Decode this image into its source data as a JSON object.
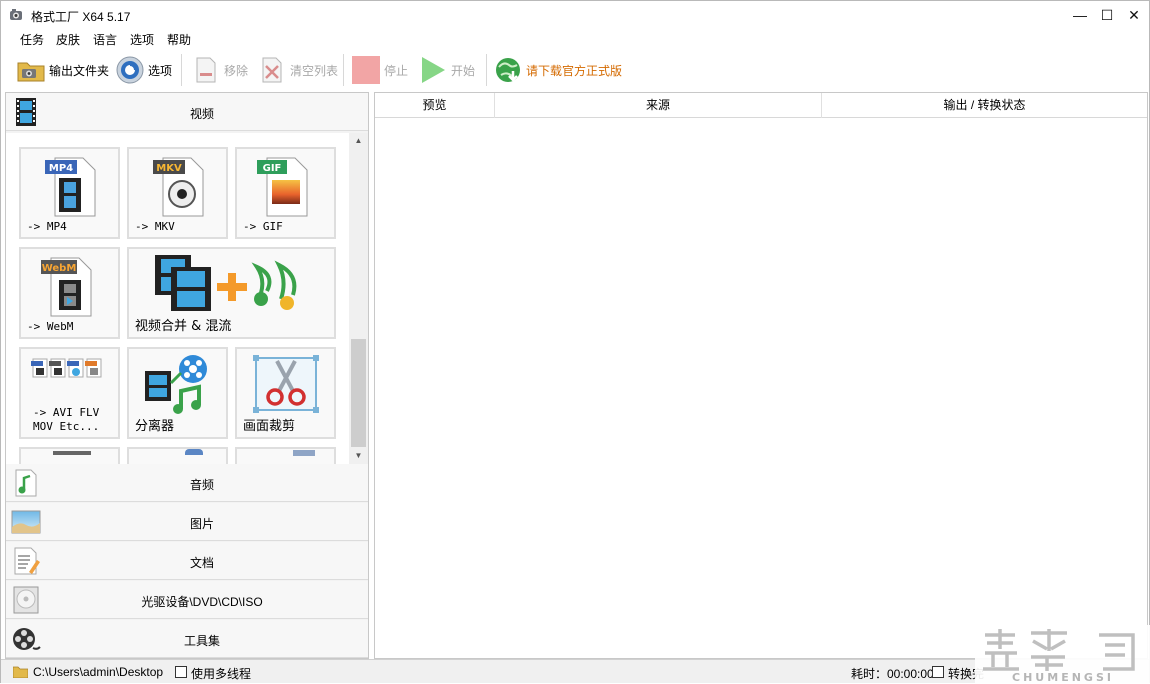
{
  "window": {
    "title": "格式工厂 X64 5.17",
    "minimize_glyph": "—",
    "maximize_glyph": "☐",
    "close_glyph": "✕"
  },
  "menu": [
    "任务",
    "皮肤",
    "语言",
    "选项",
    "帮助"
  ],
  "toolbar": {
    "output_folder": "输出文件夹",
    "options": "选项",
    "remove": "移除",
    "clear_list": "清空列表",
    "stop": "停止",
    "start": "开始",
    "download_official": "请下载官方正式版",
    "download_color": "#d46a00"
  },
  "left_panel": {
    "video_category": "视频",
    "tiles": [
      {
        "badge": "MP4",
        "badge_color": "#3a66b8",
        "label": "-> MP4"
      },
      {
        "badge": "MKV",
        "badge_color": "#4a4a4a",
        "label": "-> MKV"
      },
      {
        "badge": "GIF",
        "badge_color": "#2e9e5b",
        "label": "-> GIF"
      },
      {
        "badge": "WebM",
        "badge_color": "#555555",
        "label": "-> WebM"
      },
      {
        "label": "视频合并 & 混流"
      },
      {
        "label": "-> AVI FLV\nMOV Etc..."
      },
      {
        "label": "分离器"
      },
      {
        "label": "画面裁剪"
      }
    ],
    "categories": [
      "音频",
      "图片",
      "文档",
      "光驱设备\\DVD\\CD\\ISO",
      "工具集"
    ]
  },
  "list": {
    "columns": [
      "预览",
      "来源",
      "输出 / 转换状态"
    ]
  },
  "status": {
    "path": "C:\\Users\\admin\\Desktop",
    "multithread": "使用多线程",
    "elapsed": "耗时：00:00:00",
    "after_convert": "转换完"
  },
  "watermark": {
    "text": "CHUMENGSI"
  },
  "colors": {
    "accent_blue": "#2f6fbf",
    "start_green": "#7ed07e",
    "stop_red": "#f0a0a0"
  }
}
